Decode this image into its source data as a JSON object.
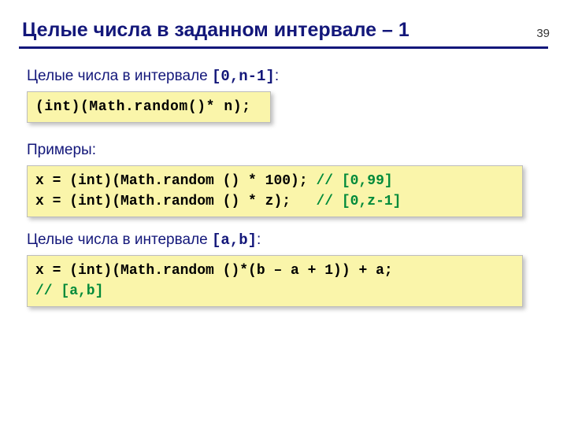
{
  "pageNumber": "39",
  "title": "Целые числа в заданном интервале – 1",
  "section1": {
    "label_pre": "Целые числа в интервале ",
    "label_code": "[0,n-1]",
    "label_post": ":",
    "code": "(int)(Math.random()* n);"
  },
  "section2": {
    "label": "Примеры:",
    "line1_code": "x = (int)(Math.random () * 100); ",
    "line1_comment": "// [0,99]",
    "line2_code": "x = (int)(Math.random () * z);   ",
    "line2_comment": "// [0,z-1]"
  },
  "section3": {
    "label_pre": "Целые числа в интервале ",
    "label_code": "[a,b]",
    "label_post": ":",
    "line1": "x = (int)(Math.random ()*(b – a + 1)) + a;",
    "line2_comment": "// [a,b]"
  }
}
